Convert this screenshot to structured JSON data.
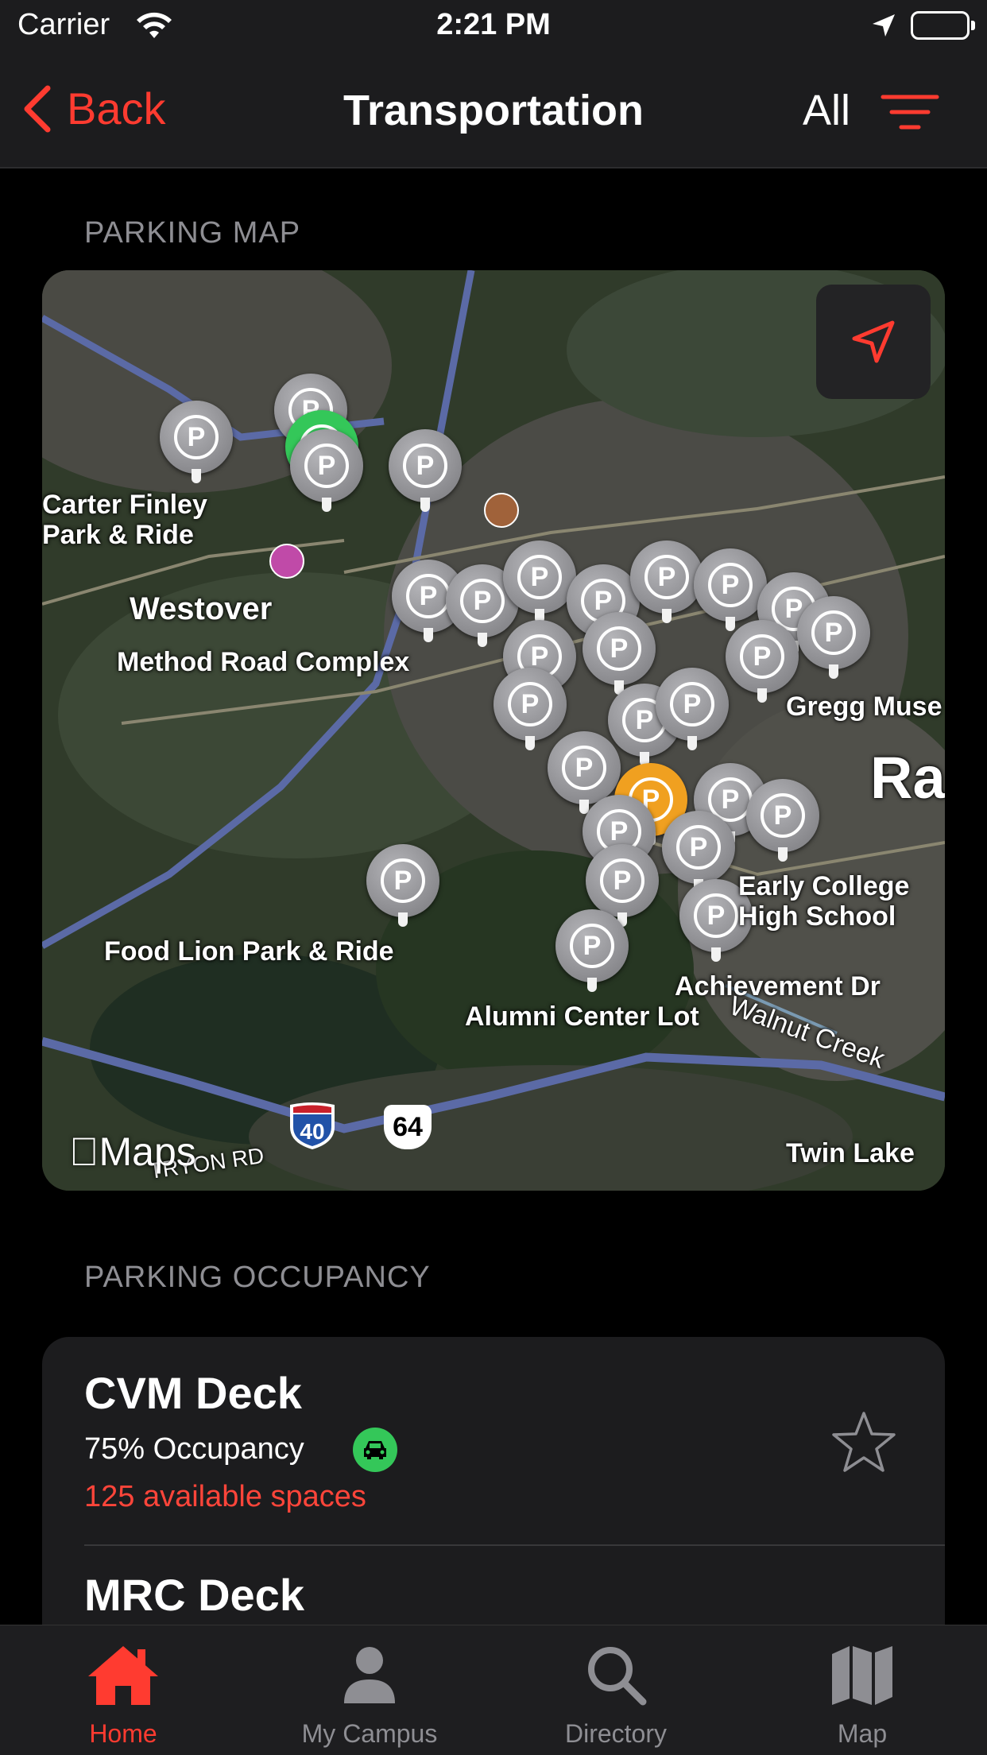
{
  "status_bar": {
    "carrier": "Carrier",
    "time": "2:21 PM"
  },
  "nav": {
    "back_label": "Back",
    "title": "Transportation",
    "filter_label": "All"
  },
  "parking_map": {
    "section_title": "PARKING MAP",
    "labels": {
      "carter_finley_1": "Carter Finley",
      "carter_finley_2": "Park & Ride",
      "westover": "Westover",
      "method_road": "Method Road Complex",
      "gregg": "Gregg Muse",
      "raleigh": "Ra",
      "early_college_1": "Early College",
      "early_college_2": "High School",
      "food_lion": "Food Lion Park & Ride",
      "achievement": "Achievement Dr",
      "alumni": "Alumni Center Lot",
      "walnut": "Walnut Creek",
      "twin_lake": "Twin Lake",
      "tryon": "TRYON RD",
      "i40": "40",
      "us64": "64",
      "maps_logo": "Maps",
      "pin_letter": "P"
    }
  },
  "parking_occupancy": {
    "section_title": "PARKING OCCUPANCY",
    "items": [
      {
        "name": "CVM Deck",
        "occupancy": "75% Occupancy",
        "available": "125 available spaces"
      },
      {
        "name": "MRC Deck"
      }
    ]
  },
  "tabs": [
    {
      "label": "Home",
      "icon": "home-icon",
      "active": true
    },
    {
      "label": "My Campus",
      "icon": "person-icon"
    },
    {
      "label": "Directory",
      "icon": "search-icon"
    },
    {
      "label": "Map",
      "icon": "map-icon"
    }
  ],
  "colors": {
    "accent": "#ff3b30",
    "available": "#34c759",
    "background": "#000000",
    "card": "#1c1c1e"
  }
}
